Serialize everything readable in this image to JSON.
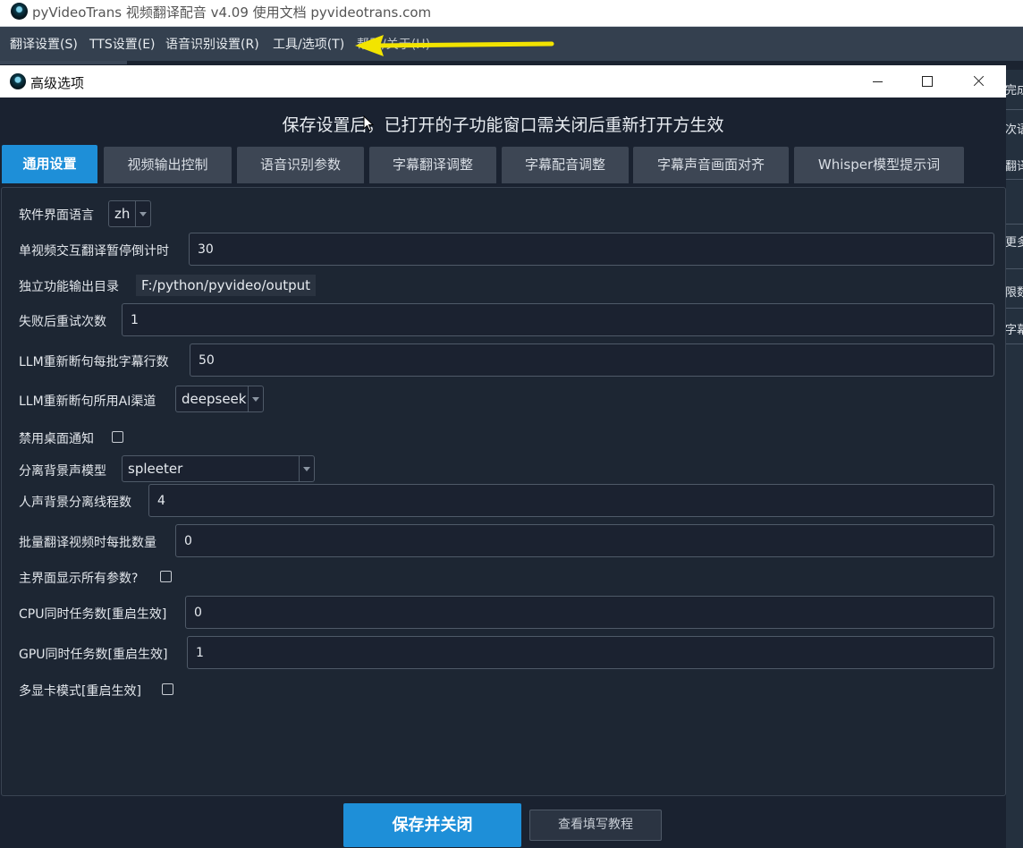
{
  "main_window": {
    "title": "pyVideoTrans 视频翻译配音 v4.09  使用文档 pyvideotrans.com",
    "menu": [
      "翻译设置(S)",
      "TTS设置(E)",
      "语音识别设置(R)",
      "工具/选项(T)",
      "帮助/关于(H)"
    ],
    "right_fragments": [
      "完成",
      "次语",
      "翻译",
      "更多",
      "限数",
      "字幕"
    ]
  },
  "dialog": {
    "title": "高级选项",
    "notice": "保存设置后，已打开的子功能窗口需关闭后重新打开方生效",
    "tabs": [
      "通用设置",
      "视频输出控制",
      "语音识别参数",
      "字幕翻译调整",
      "字幕配音调整",
      "字幕声音画面对齐",
      "Whisper模型提示词"
    ],
    "active_tab": "通用设置",
    "fields": {
      "ui_language": {
        "label": "软件界面语言",
        "value": "zh"
      },
      "countdown": {
        "label": "单视频交互翻译暂停倒计时",
        "value": "30"
      },
      "output_dir": {
        "label": "独立功能输出目录",
        "value": "F:/python/pyvideo/output"
      },
      "retry": {
        "label": "失败后重试次数",
        "value": "1"
      },
      "llm_batch": {
        "label": "LLM重新断句每批字幕行数",
        "value": "50"
      },
      "llm_channel": {
        "label": "LLM重新断句所用AI渠道",
        "value": "deepseek"
      },
      "disable_notify": {
        "label": "禁用桌面通知",
        "checked": false
      },
      "separation_model": {
        "label": "分离背景声模型",
        "value": "spleeter"
      },
      "separation_threads": {
        "label": "人声背景分离线程数",
        "value": "4"
      },
      "batch_count": {
        "label": "批量翻译视频时每批数量",
        "value": "0"
      },
      "show_all_params": {
        "label": "主界面显示所有参数?",
        "checked": false
      },
      "cpu_tasks": {
        "label": "CPU同时任务数[重启生效]",
        "value": "0"
      },
      "gpu_tasks": {
        "label": "GPU同时任务数[重启生效]",
        "value": "1"
      },
      "multi_gpu": {
        "label": "多显卡模式[重启生效]",
        "checked": false
      }
    },
    "buttons": {
      "save": "保存并关闭",
      "help": "查看填写教程"
    }
  },
  "colors": {
    "accent": "#1e8fd8",
    "background": "#1d2633",
    "annotation_arrow": "#f2e400"
  }
}
